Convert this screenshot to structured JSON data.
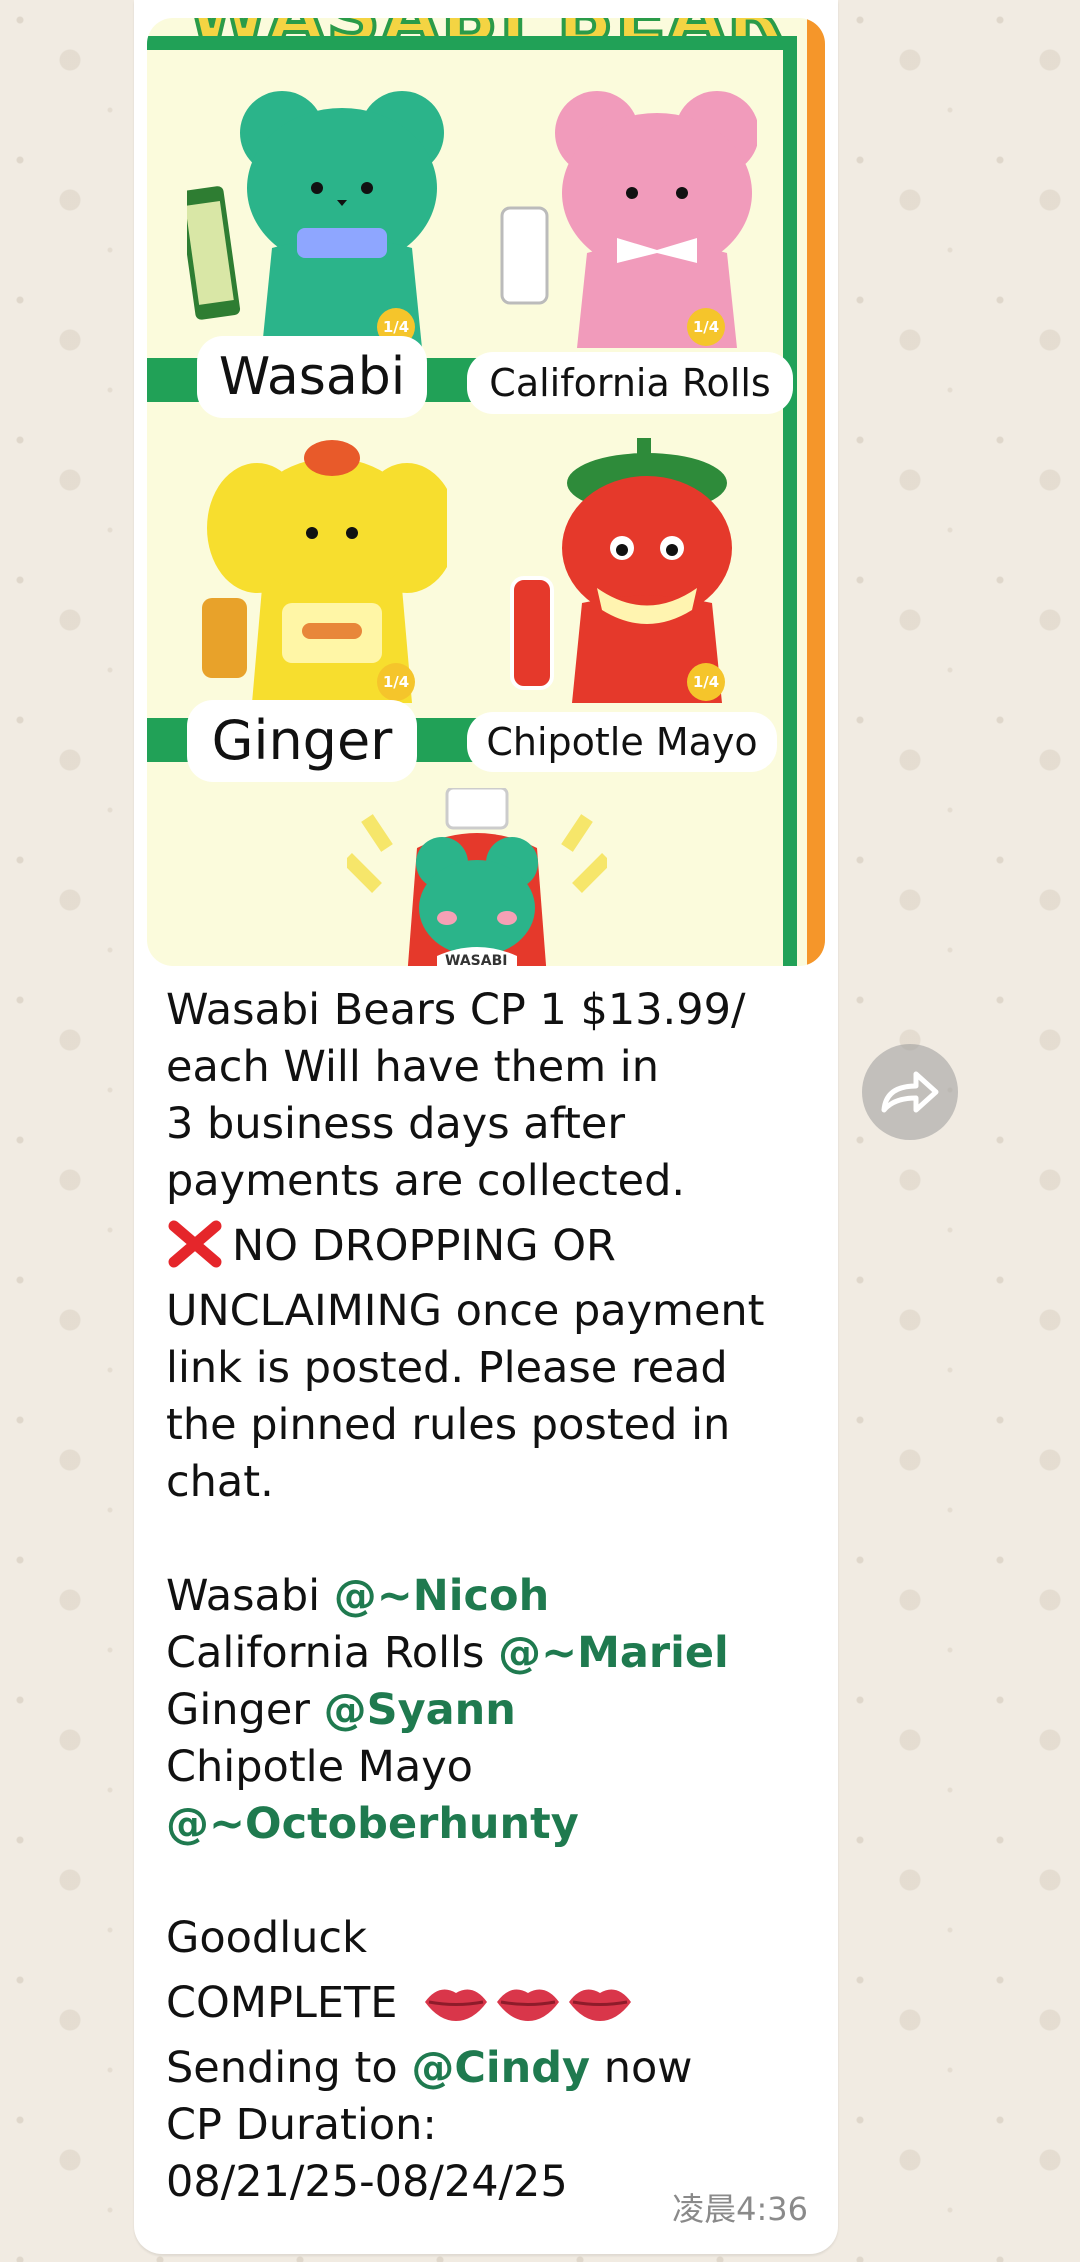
{
  "image": {
    "title": "WASABI BEAR",
    "items": [
      {
        "name": "Wasabi",
        "badge": "1/4"
      },
      {
        "name": "California Rolls",
        "badge": "1/4"
      },
      {
        "name": "Ginger",
        "badge": "1/4"
      },
      {
        "name": "Chipotle Mayo",
        "badge": "1/4"
      }
    ],
    "bottle_label": "WASABI"
  },
  "message": {
    "intro_lines": [
      "Wasabi Bears CP 1 $13.99/",
      "each Will have them in",
      "3 business days after",
      "payments are collected."
    ],
    "warning_line1": "NO DROPPING OR",
    "warning_lines": [
      "UNCLAIMING once payment",
      "link is posted. Please read",
      "the pinned rules posted in",
      "chat."
    ],
    "claims": [
      {
        "item": "Wasabi ",
        "mention": "@~Nicoh"
      },
      {
        "item": "California Rolls ",
        "mention": "@~Mariel"
      },
      {
        "item": "Ginger ",
        "mention": "@Syann"
      }
    ],
    "claim4_item": "Chipotle Mayo",
    "claim4_mention": "@~Octoberhunty",
    "goodluck": "Goodluck",
    "complete": "COMPLETE",
    "sending_prefix": "Sending to ",
    "sending_mention": "@Cindy",
    "sending_suffix": " now",
    "duration_label": "CP Duration:",
    "duration_value": "08/21/25-08/24/25",
    "timestamp": "凌晨4:36"
  },
  "colors": {
    "mention": "#1f7a4f",
    "green": "#21a157",
    "orange": "#f5962a"
  },
  "icons": {
    "warning": "cross-mark-icon",
    "complete": "lips-icon",
    "forward": "forward-arrow-icon"
  }
}
